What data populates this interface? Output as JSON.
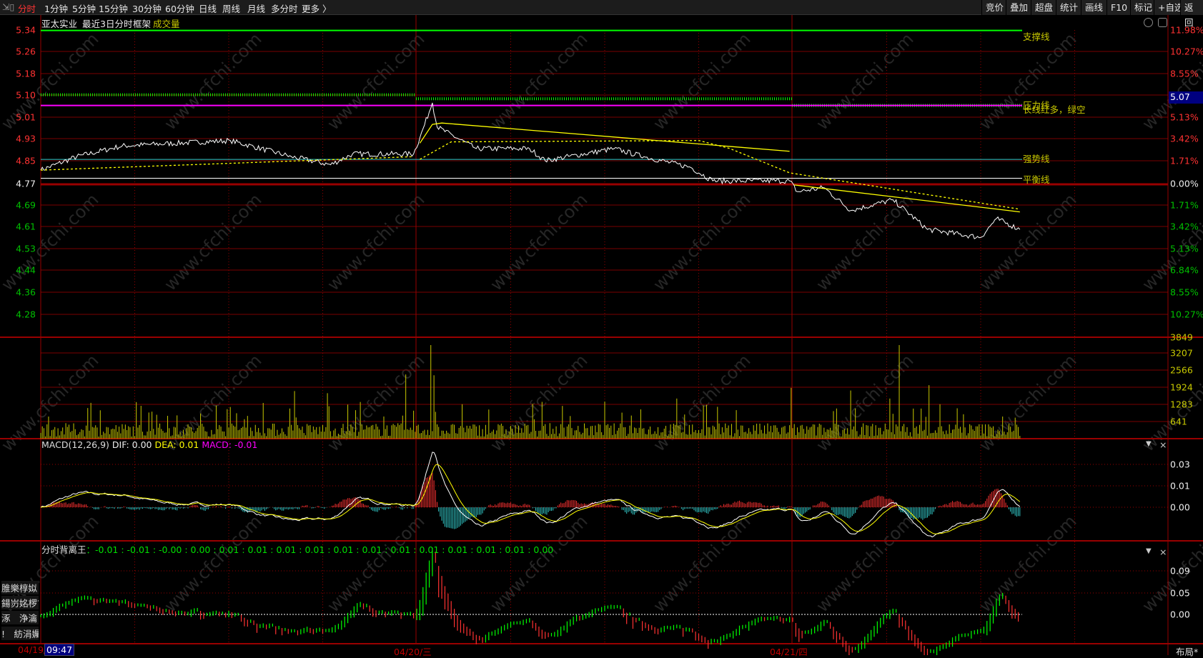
{
  "topbar": {
    "periods": [
      {
        "label": "分时",
        "active": true
      },
      {
        "label": "1分钟"
      },
      {
        "label": "5分钟"
      },
      {
        "label": "15分钟"
      },
      {
        "label": "30分钟"
      },
      {
        "label": "60分钟"
      },
      {
        "label": "日线"
      },
      {
        "label": "周线"
      },
      {
        "label": "月线"
      },
      {
        "label": "多分时"
      },
      {
        "label": "更多 〉"
      }
    ],
    "buttons": [
      "竞价",
      "叠加",
      "超盘",
      "统计",
      "画线",
      "F10",
      "标记",
      "+自选",
      "返回"
    ]
  },
  "header": {
    "stock": "亚太实业",
    "mode": "最近3日分时",
    "frame": "框架",
    "volume_label": "成交量"
  },
  "price_axis": {
    "left": [
      "5.34",
      "5.26",
      "5.18",
      "5.10",
      "5.01",
      "4.93",
      "4.85",
      "4.77",
      "4.69",
      "4.61",
      "4.53",
      "4.44",
      "4.36",
      "4.28"
    ],
    "right": [
      "11.98%",
      "10.27%",
      "8.55%",
      "",
      "5.13%",
      "3.42%",
      "1.71%",
      "0.00%",
      "1.71%",
      "3.42%",
      "5.13%",
      "6.84%",
      "8.55%",
      "10.27%"
    ],
    "current_price_box": "5.07"
  },
  "volume_axis": [
    "3849",
    "3207",
    "2566",
    "1924",
    "1283",
    "641"
  ],
  "line_labels": {
    "support": "支撑线",
    "pressure": "压力线",
    "trend_note": "长线红多，绿空",
    "strong": "强势线",
    "balance": "平衡线"
  },
  "levels": {
    "support": 5.34,
    "pressure": 5.06,
    "strong": 4.86,
    "balance": 4.79,
    "dashed": [
      5.1,
      5.085,
      5.06
    ]
  },
  "colors": {
    "up": "#ff3232",
    "down": "#00c000",
    "grid": "#7a0000",
    "avg": "#ffff00",
    "volume": "#c8c800",
    "macd_neg": "#33cccc",
    "support": "#00ff00",
    "pressure": "#ff00ff",
    "strong": "#33cccc"
  },
  "price_anchors": [
    [
      0,
      4.82
    ],
    [
      23,
      4.87
    ],
    [
      52,
      4.91
    ],
    [
      121,
      4.93
    ],
    [
      160,
      4.87
    ],
    [
      185,
      4.84
    ],
    [
      199,
      4.88
    ],
    [
      238,
      4.88
    ],
    [
      242,
      4.94
    ],
    [
      250,
      5.07
    ],
    [
      253,
      4.98
    ],
    [
      278,
      4.9
    ],
    [
      312,
      4.9
    ],
    [
      322,
      4.855
    ],
    [
      366,
      4.9
    ],
    [
      385,
      4.87
    ],
    [
      415,
      4.83
    ],
    [
      429,
      4.78
    ],
    [
      478,
      4.78
    ],
    [
      483,
      4.74
    ],
    [
      500,
      4.755
    ],
    [
      517,
      4.67
    ],
    [
      544,
      4.71
    ],
    [
      566,
      4.6
    ],
    [
      600,
      4.57
    ],
    [
      610,
      4.64
    ],
    [
      625,
      4.6
    ]
  ],
  "avg_lines": {
    "solid": [
      [
        [
          242,
          4.92
        ],
        [
          250,
          4.99
        ],
        [
          256,
          4.995
        ],
        [
          478,
          4.89
        ]
      ],
      [
        [
          481,
          4.765
        ],
        [
          625,
          4.665
        ]
      ]
    ],
    "dotted": [
      [
        [
          0,
          4.82
        ],
        [
          238,
          4.87
        ]
      ],
      [
        [
          242,
          4.86
        ],
        [
          262,
          4.925
        ],
        [
          420,
          4.93
        ],
        [
          440,
          4.9
        ],
        [
          478,
          4.81
        ],
        [
          625,
          4.675
        ]
      ]
    ]
  },
  "volume_spikes": [
    [
      162,
      1780
    ],
    [
      183,
      1700
    ],
    [
      233,
      2400
    ],
    [
      249,
      3500
    ],
    [
      251,
      2370
    ],
    [
      406,
      1500
    ],
    [
      479,
      1900
    ],
    [
      517,
      1800
    ],
    [
      542,
      1500
    ],
    [
      548,
      3500
    ],
    [
      567,
      2000
    ]
  ],
  "macd": {
    "title": "MACD(12,26,9)",
    "dif": "DIF: 0.00",
    "dea": "DEA: 0.01",
    "macd": "MACD: -0.01",
    "axis": [
      "0.03",
      "0.01",
      "0.00"
    ]
  },
  "divergence": {
    "title": "分时背离王",
    "values": "：-0.01 : -0.01 : -0.00 : 0.00 : 0.01 : 0.01 : 0.01 : 0.01 : 0.01 : 0.01 : 0.01 : 0.01 : 0.01 : 0.01 : 0.01 : 0.00",
    "axis": [
      "0.09",
      "0.05",
      "0.00"
    ]
  },
  "side_panel": [
    "脽樂椁姒",
    "鍚岃姳椤?(",
    "涿　浄瀹",
    "!　紡涓孎"
  ],
  "dates": {
    "d1": "04/19/",
    "cursor_time": "09:47",
    "d2": "04/20/三",
    "d3": "04/21/四"
  },
  "layout_button": "布局*",
  "watermark": "www.cfchi.com"
}
